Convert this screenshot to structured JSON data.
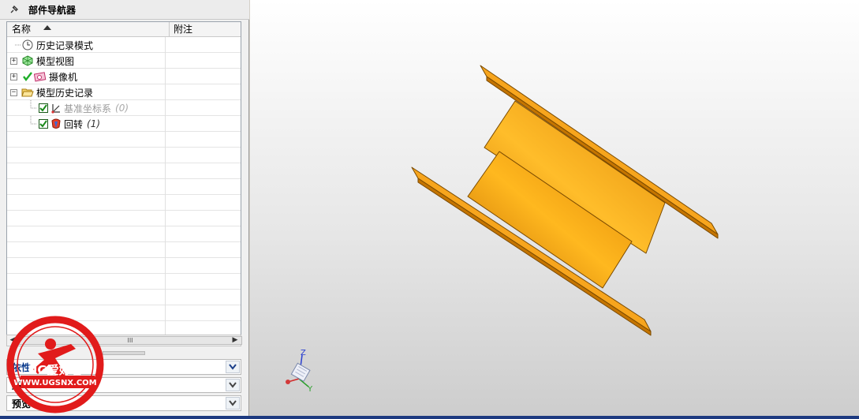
{
  "navigator": {
    "title": "部件导航器",
    "columns": {
      "name": "名称",
      "notes": "附注"
    },
    "rows": [
      {
        "label": "历史记录模式",
        "suffix": "",
        "icon": "clock-icon"
      },
      {
        "label": "模型视图",
        "suffix": "",
        "icon": "model-view-icon"
      },
      {
        "label": "摄像机",
        "suffix": "",
        "icon": "camera-icon"
      },
      {
        "label": "模型历史记录",
        "suffix": "",
        "icon": "folder-open-icon"
      },
      {
        "label": "基准坐标系",
        "suffix": "(0)",
        "icon": "datum-csys-icon"
      },
      {
        "label": "回转",
        "suffix": "(1)",
        "icon": "revolve-icon"
      }
    ],
    "scroll_thumb": "III",
    "sections": [
      "依性",
      "细",
      "预览"
    ]
  },
  "triad": {
    "z": "Z",
    "y": "Y"
  },
  "watermark": {
    "text": "UG爱好者",
    "url": "WWW.UGSNX.COM"
  },
  "colors": {
    "part": "#f5a21a",
    "part_edge": "#6b4300",
    "selection": "#0a3a8c"
  }
}
